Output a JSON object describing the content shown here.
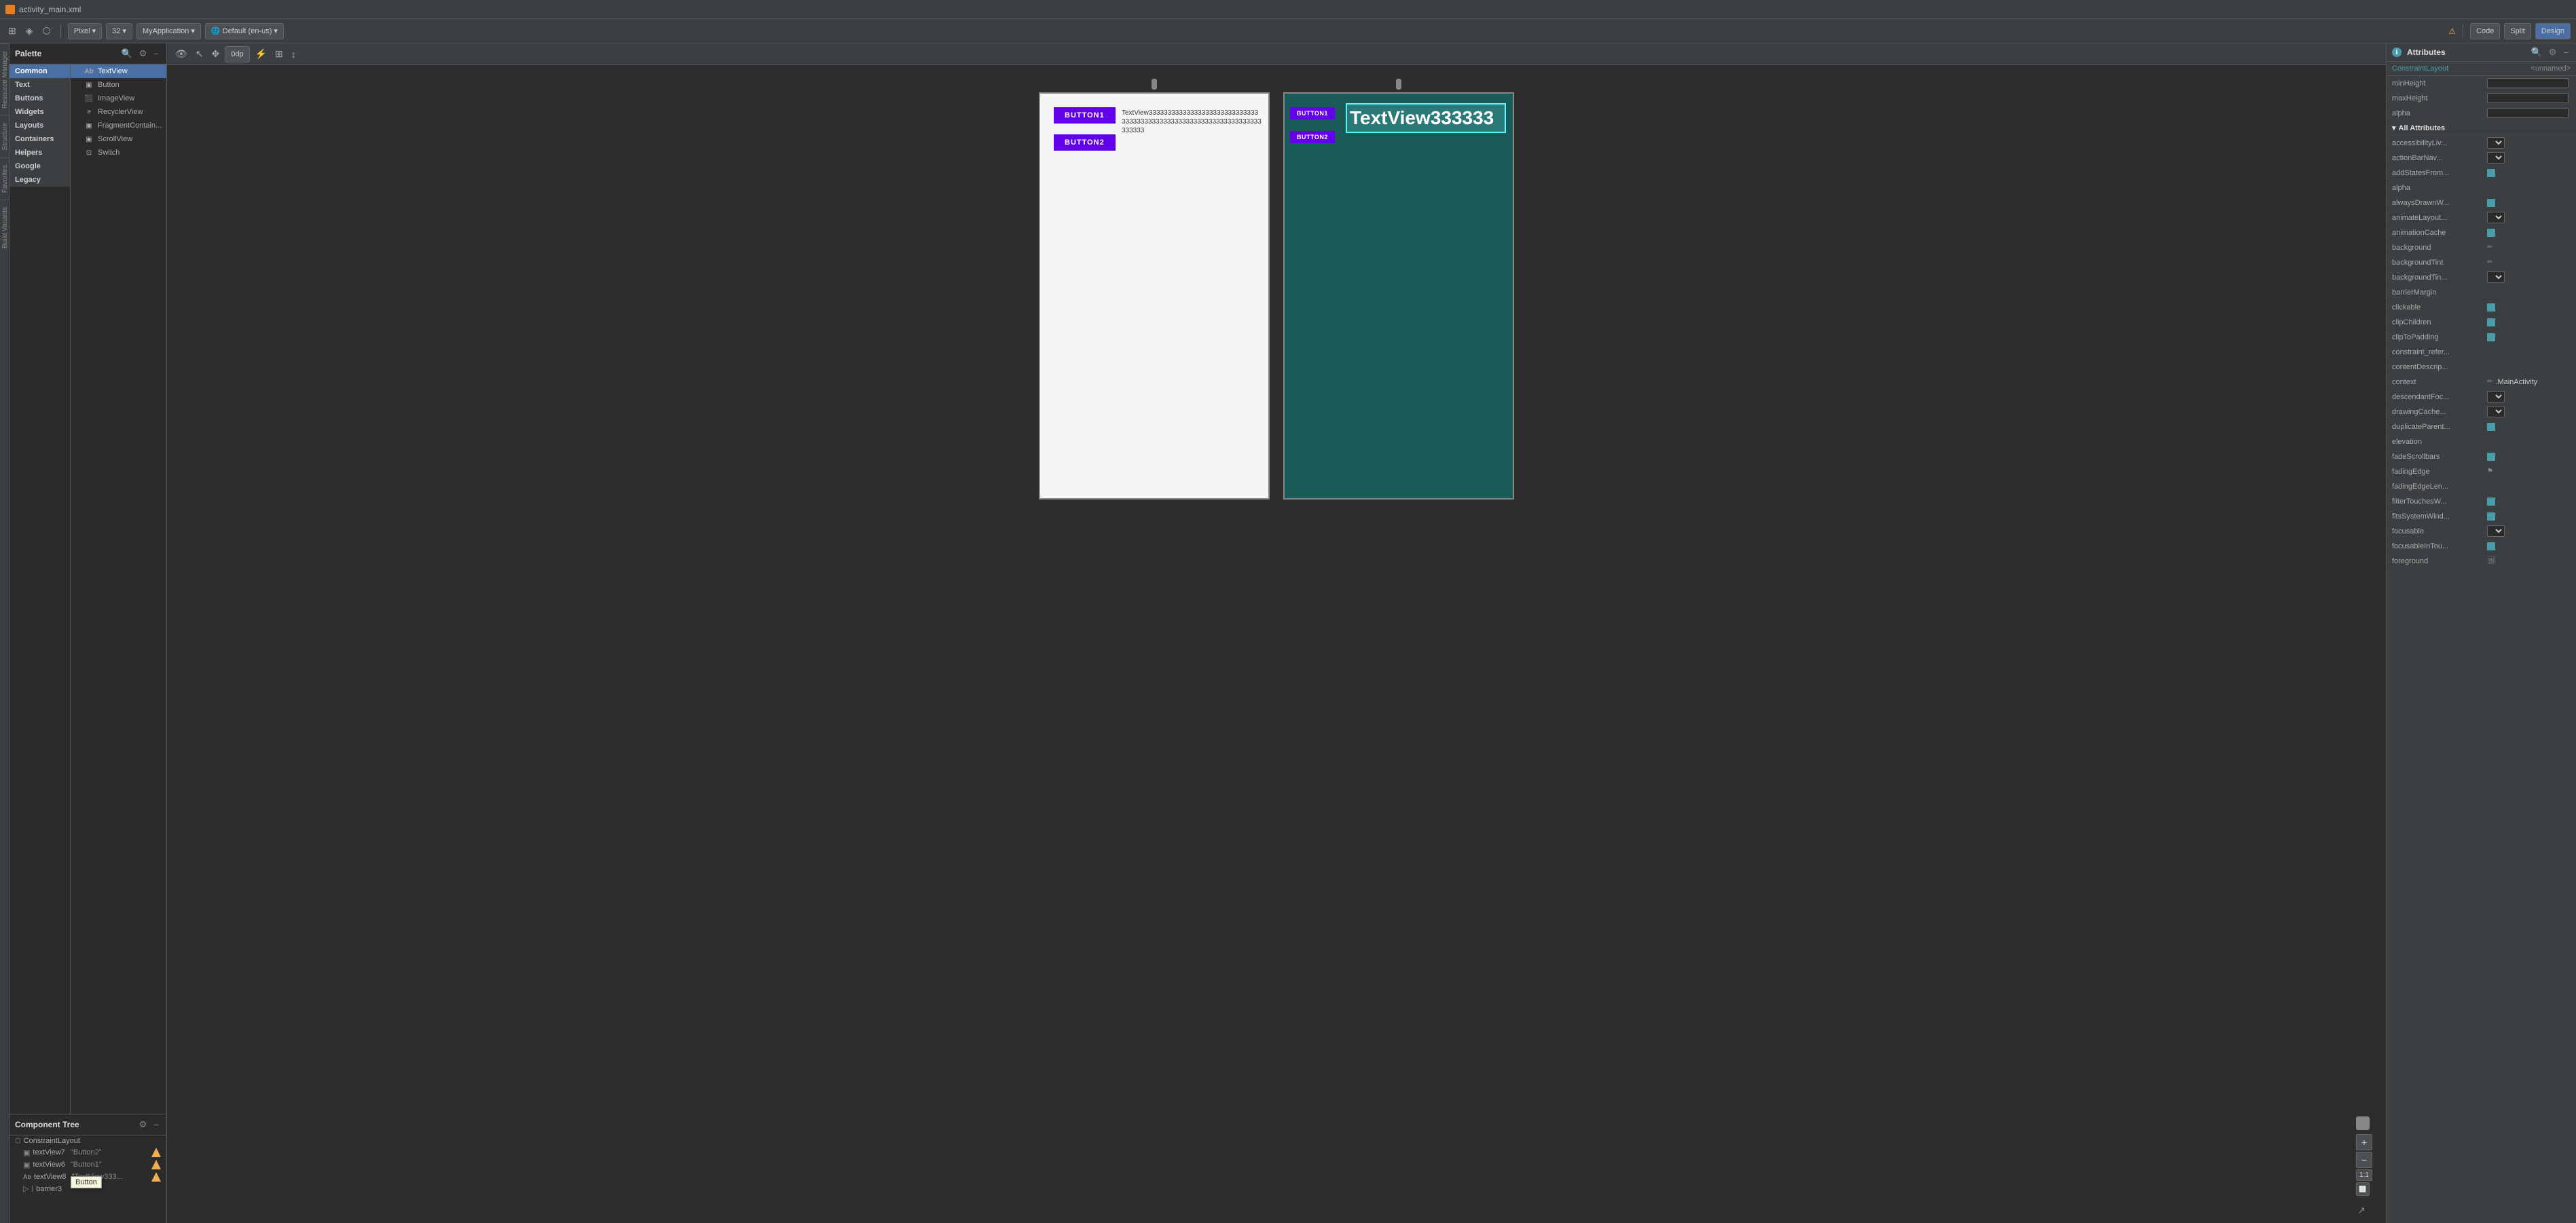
{
  "titleBar": {
    "icon": "android",
    "filename": "activity_main.xml"
  },
  "topToolbar": {
    "codeBtn": "Code",
    "splitBtn": "Split",
    "designBtn": "Design",
    "viewToggle1": "blueprint-icon",
    "viewToggle2": "design-icon",
    "pixelLabel": "Pixel",
    "dpValue": "32",
    "appName": "MyApplication",
    "locale": "Default (en-us)"
  },
  "secondaryToolbar": {
    "eyeBtn": "eye-icon",
    "cursorBtn": "cursor-icon",
    "panBtn": "pan-icon",
    "zoomValue": "0dp",
    "transformBtn": "transform-icon",
    "alignBtn": "align-icon",
    "guideBtn": "guide-icon"
  },
  "palette": {
    "title": "Palette",
    "searchPlaceholder": "Search",
    "categories": [
      {
        "id": "common",
        "label": "Common",
        "selected": true
      },
      {
        "id": "text",
        "label": "Text"
      },
      {
        "id": "buttons",
        "label": "Buttons"
      },
      {
        "id": "widgets",
        "label": "Widgets"
      },
      {
        "id": "layouts",
        "label": "Layouts"
      },
      {
        "id": "containers",
        "label": "Containers"
      },
      {
        "id": "helpers",
        "label": "Helpers"
      },
      {
        "id": "google",
        "label": "Google"
      },
      {
        "id": "legacy",
        "label": "Legacy"
      }
    ],
    "commonItems": [
      {
        "id": "textview",
        "label": "TextView",
        "icon": "Ab"
      },
      {
        "id": "button",
        "label": "Button",
        "icon": "▣"
      },
      {
        "id": "imageview",
        "label": "ImageView",
        "icon": "⬛"
      },
      {
        "id": "recyclerview",
        "label": "RecyclerView",
        "icon": "≡"
      },
      {
        "id": "fragmentcontain",
        "label": "FragmentContain...",
        "icon": "▣"
      },
      {
        "id": "scrollview",
        "label": "ScrollView",
        "icon": "▣"
      },
      {
        "id": "switch",
        "label": "Switch",
        "icon": "⊡"
      }
    ]
  },
  "componentTree": {
    "title": "Component Tree",
    "items": [
      {
        "id": "constraintlayout",
        "label": "ConstraintLayout",
        "indent": 0,
        "icon": "layout"
      },
      {
        "id": "textview7",
        "label": "textView7",
        "sublabel": "\"Button2\"",
        "indent": 1,
        "icon": "button",
        "hasWarning": true
      },
      {
        "id": "textview6",
        "label": "textView6",
        "sublabel": "\"Button1\"",
        "indent": 1,
        "icon": "button",
        "hasWarning": true
      },
      {
        "id": "textview8",
        "label": "textView8",
        "sublabel": "\"TextView333...",
        "indent": 1,
        "icon": "textview",
        "hasWarning": true
      },
      {
        "id": "barrier3",
        "label": "barrier3",
        "indent": 1,
        "icon": "barrier",
        "expanded": false
      }
    ],
    "tooltip": "Button"
  },
  "canvas": {
    "preview1": {
      "btn1Label": "BUTTON1",
      "btn2Label": "BUTTON2",
      "textContent": "TextView333333333333333333333333333333333333333333333333333333333333333333333333"
    },
    "preview2": {
      "btn1Label": "BUTTON1",
      "btn2Label": "BUTTON2",
      "textContent": "TextView333333"
    }
  },
  "zoom": {
    "plusLabel": "+",
    "minusLabel": "−",
    "ratioLabel": "1:1"
  },
  "attributes": {
    "title": "Attributes",
    "searchPlaceholder": "Search attributes",
    "layoutId": "<unnamed>",
    "layoutType": "ConstraintLayout",
    "warningIcon": "warning",
    "rows": [
      {
        "name": "minHeight",
        "value": "",
        "type": "input"
      },
      {
        "name": "maxHeight",
        "value": "",
        "type": "input"
      },
      {
        "name": "alpha",
        "value": "",
        "type": "input"
      },
      {
        "name": "All Attributes",
        "type": "section"
      },
      {
        "name": "accessibilityLiv...",
        "value": "",
        "type": "dropdown"
      },
      {
        "name": "actionBarNav...",
        "value": "",
        "type": "dropdown"
      },
      {
        "name": "addStatesFrom...",
        "value": "",
        "type": "icon-blue"
      },
      {
        "name": "alpha",
        "value": "",
        "type": "input"
      },
      {
        "name": "alwaysDrawnW...",
        "value": "",
        "type": "icon-blue"
      },
      {
        "name": "animateLayout...",
        "value": "",
        "type": "dropdown"
      },
      {
        "name": "animationCache",
        "value": "",
        "type": "icon-blue"
      },
      {
        "name": "background",
        "value": "",
        "type": "pencil"
      },
      {
        "name": "backgroundTint",
        "value": "",
        "type": "pencil"
      },
      {
        "name": "backgroundTin...",
        "value": "",
        "type": "dropdown"
      },
      {
        "name": "barrierMargin",
        "value": "",
        "type": "input"
      },
      {
        "name": "clickable",
        "value": "",
        "type": "icon-blue"
      },
      {
        "name": "clipChildren",
        "value": "",
        "type": "icon-blue"
      },
      {
        "name": "clipToPadding",
        "value": "",
        "type": "icon-blue"
      },
      {
        "name": "constraint_refer...",
        "value": "",
        "type": "input"
      },
      {
        "name": "contentDescrip...",
        "value": "",
        "type": "input"
      },
      {
        "name": "context",
        "value": ".MainActivity",
        "type": "pencil"
      },
      {
        "name": "descendantFoc...",
        "value": "",
        "type": "dropdown"
      },
      {
        "name": "drawingCache...",
        "value": "",
        "type": "dropdown"
      },
      {
        "name": "duplicateParent...",
        "value": "",
        "type": "icon-blue"
      },
      {
        "name": "elevation",
        "value": "",
        "type": "input"
      },
      {
        "name": "fadeScrollbars",
        "value": "",
        "type": "icon-blue"
      },
      {
        "name": "fadingEdge",
        "value": "",
        "type": "flag"
      },
      {
        "name": "fadingEdgeLen...",
        "value": "",
        "type": "input"
      },
      {
        "name": "filterTouchesW...",
        "value": "",
        "type": "icon-blue"
      },
      {
        "name": "fitsSystemWind...",
        "value": "",
        "type": "icon-blue"
      },
      {
        "name": "focusable",
        "value": "",
        "type": "dropdown"
      },
      {
        "name": "focusableInTou...",
        "value": "",
        "type": "icon-blue"
      },
      {
        "name": "foreground",
        "value": "",
        "type": "img"
      }
    ]
  },
  "sideTabs": [
    "Resource Manager",
    "Structure",
    "Favorites",
    "Build Variants"
  ]
}
